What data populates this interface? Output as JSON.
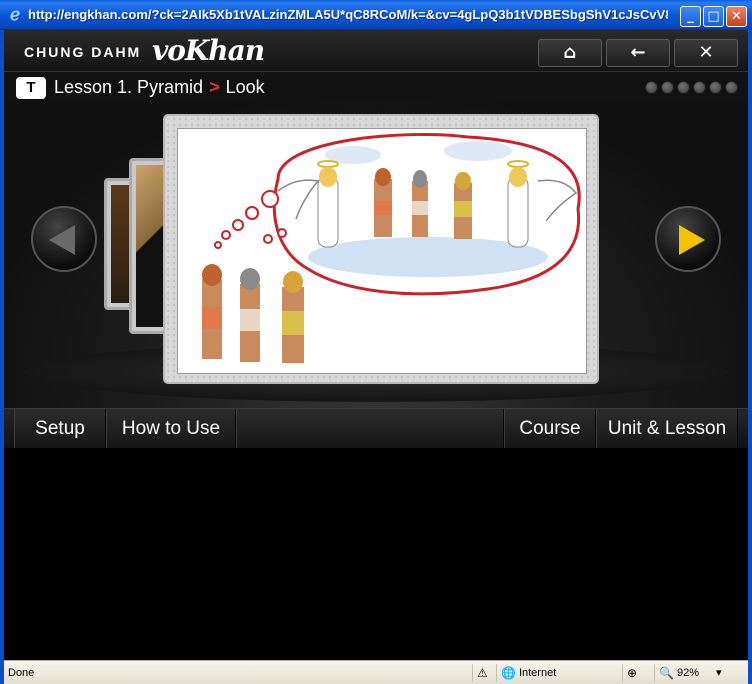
{
  "window": {
    "title": "http://engkhan.com/?ck=2AIk5Xb1tVALzinZMLA5U*qC8RCoM/k=&cv=4gLpQ3b1tVDBESbgShV1cJsCvV8...",
    "minimize_icon": "minimize-icon",
    "maximize_icon": "maximize-icon",
    "close_icon": "close-icon"
  },
  "header": {
    "brand": "CHUNG DAHM",
    "brand_script": "voKhan",
    "buttons": [
      {
        "icon": "home-icon",
        "glyph": "⌂"
      },
      {
        "icon": "back-arrow-icon",
        "glyph": "←"
      },
      {
        "icon": "close-icon",
        "glyph": "✕"
      }
    ]
  },
  "lesson": {
    "badge": "T",
    "title": "Lesson 1. Pyramid",
    "separator": ">",
    "section": "Look",
    "progress_dots": 6
  },
  "menu": {
    "setup": "Setup",
    "how_to_use": "How to Use",
    "course": "Course",
    "unit_lesson": "Unit & Lesson"
  },
  "status": {
    "left": "Done",
    "zone": "Internet",
    "zoom": "92%"
  },
  "colors": {
    "accent_yellow": "#f5c300",
    "separator_red": "#e0322a",
    "titlebar_blue": "#0b58d6"
  }
}
